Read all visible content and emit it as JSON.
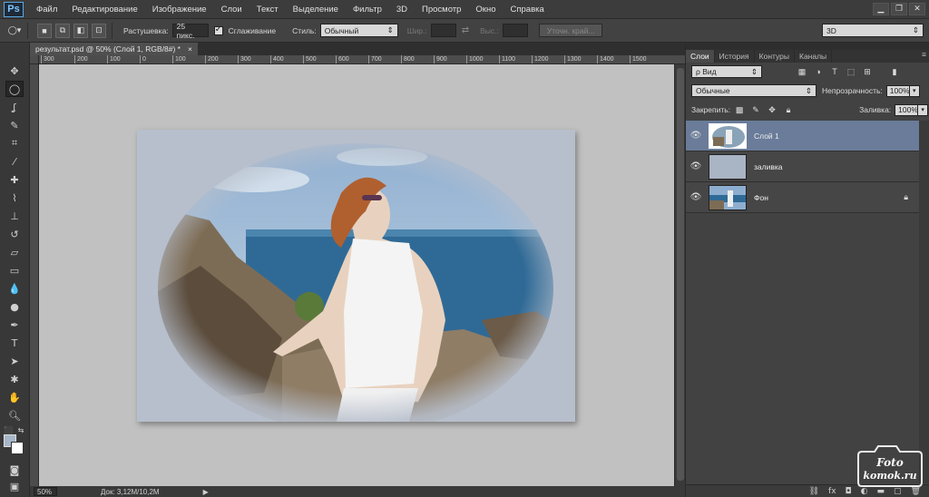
{
  "app": {
    "logo": "Ps"
  },
  "menu": [
    "Файл",
    "Редактирование",
    "Изображение",
    "Слои",
    "Текст",
    "Выделение",
    "Фильтр",
    "3D",
    "Просмотр",
    "Окно",
    "Справка"
  ],
  "window_controls": {
    "minimize": "▁",
    "maximize": "❐",
    "close": "✕"
  },
  "options": {
    "feather_label": "Растушевка:",
    "feather_value": "25 пикс.",
    "antialias_label": "Сглаживание",
    "style_label": "Стиль:",
    "style_value": "Обычный",
    "width_label": "Шир.:",
    "height_label": "Выс.:",
    "refine_button": "Уточн. край...",
    "workspace_value": "3D"
  },
  "document": {
    "tab_title": "результат.psd @ 50% (Слой 1, RGB/8#) *",
    "tab_close": "×",
    "ruler_ticks": [
      "300",
      "200",
      "100",
      "0",
      "100",
      "200",
      "300",
      "400",
      "500",
      "600",
      "700",
      "800",
      "900",
      "1000",
      "1100",
      "1200",
      "1300",
      "1400",
      "1500"
    ]
  },
  "status": {
    "zoom": "50%",
    "doc_size": "Док: 3,12M/10,2M",
    "arrow": "▶"
  },
  "panel": {
    "tabs": [
      "Слои",
      "История",
      "Контуры",
      "Каналы"
    ],
    "menu_icon": "≡",
    "filter_kind": "ρ Вид",
    "blend_mode": "Обычные",
    "opacity_label": "Непрозрачность:",
    "opacity_value": "100%",
    "lock_label": "Закрепить:",
    "fill_label": "Заливка:",
    "fill_value": "100%",
    "layers": [
      {
        "name": "Слой 1",
        "selected": true,
        "locked": false
      },
      {
        "name": "заливка",
        "selected": false,
        "locked": false
      },
      {
        "name": "Фон",
        "selected": false,
        "locked": true
      }
    ],
    "bottom_icons": [
      "link-icon",
      "fx-icon",
      "mask-icon",
      "adjustment-icon",
      "group-icon",
      "new-layer-icon",
      "trash-icon"
    ]
  },
  "watermark": {
    "line1": "Foto",
    "line2": "komok.ru"
  },
  "colors": {
    "foreground": "#a7b6c8",
    "background": "#ffffff",
    "selected_layer": "#6a7c99",
    "canvas_bg": "#c1c1c1"
  }
}
